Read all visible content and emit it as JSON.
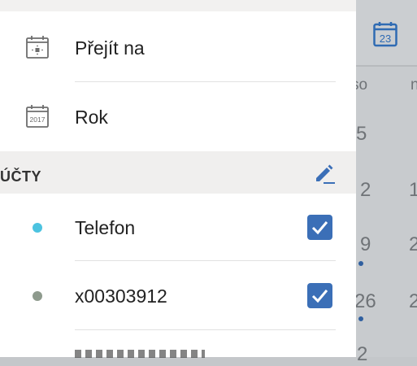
{
  "menu": {
    "goto_label": "Přejít na",
    "year_label": "Rok",
    "year_icon_text": "2017"
  },
  "accounts": {
    "title": "ÚČTY",
    "items": [
      {
        "label": "Telefon",
        "dot_color": "#4cc3e0",
        "checked": true
      },
      {
        "label": "x00303912",
        "dot_color": "#8e9a8d",
        "checked": true
      }
    ]
  },
  "calendar": {
    "today_number": "23",
    "day_headers": [
      "so",
      "n"
    ],
    "dates": [
      "5",
      "2",
      "1",
      "9",
      "2",
      "26",
      "2",
      "2"
    ]
  },
  "colors": {
    "accent": "#3b6fb7",
    "drawer_bg": "#ffffff",
    "section_bg": "#f0efee"
  }
}
